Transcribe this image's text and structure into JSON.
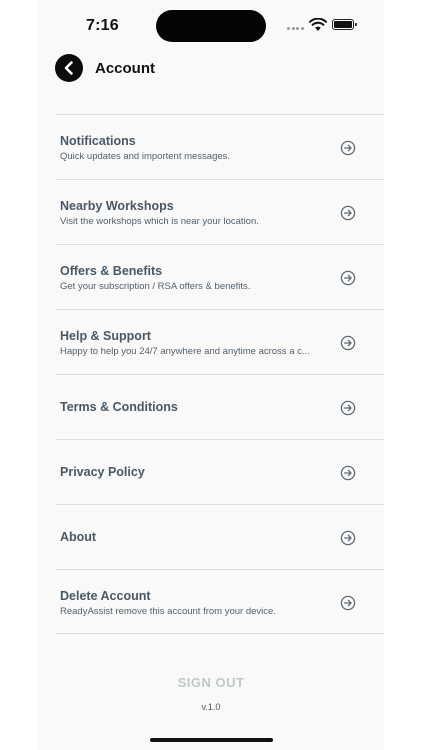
{
  "status_bar": {
    "time": "7:16"
  },
  "header": {
    "title": "Account",
    "back_icon": "chevron-left-icon"
  },
  "menu": [
    {
      "title": "Notifications",
      "subtitle": "Quick updates and importent messages.",
      "icon": "arrow-right-circle-icon"
    },
    {
      "title": "Nearby Workshops",
      "subtitle": "Visit the workshops which is near your location.",
      "icon": "arrow-right-circle-icon"
    },
    {
      "title": "Offers & Benefits",
      "subtitle": "Get your subscription / RSA offers & benefits.",
      "icon": "arrow-right-circle-icon"
    },
    {
      "title": "Help & Support",
      "subtitle": "Happy to help you 24/7 anywhere and anytime across a c...",
      "icon": "arrow-right-circle-icon"
    },
    {
      "title": "Terms & Conditions",
      "subtitle": "",
      "icon": "arrow-right-circle-icon"
    },
    {
      "title": "Privacy Policy",
      "subtitle": "",
      "icon": "arrow-right-circle-icon"
    },
    {
      "title": "About",
      "subtitle": "",
      "icon": "arrow-right-circle-icon"
    },
    {
      "title": "Delete Account",
      "subtitle": "ReadyAssist remove this account from your device.",
      "icon": "arrow-right-circle-icon"
    }
  ],
  "footer": {
    "signout_label": "SIGN OUT",
    "version": "v.1.0"
  },
  "colors": {
    "background": "#f9f9f9",
    "text": "#4b5863",
    "signout": "#c3c6c9",
    "divider": "#dedede"
  }
}
